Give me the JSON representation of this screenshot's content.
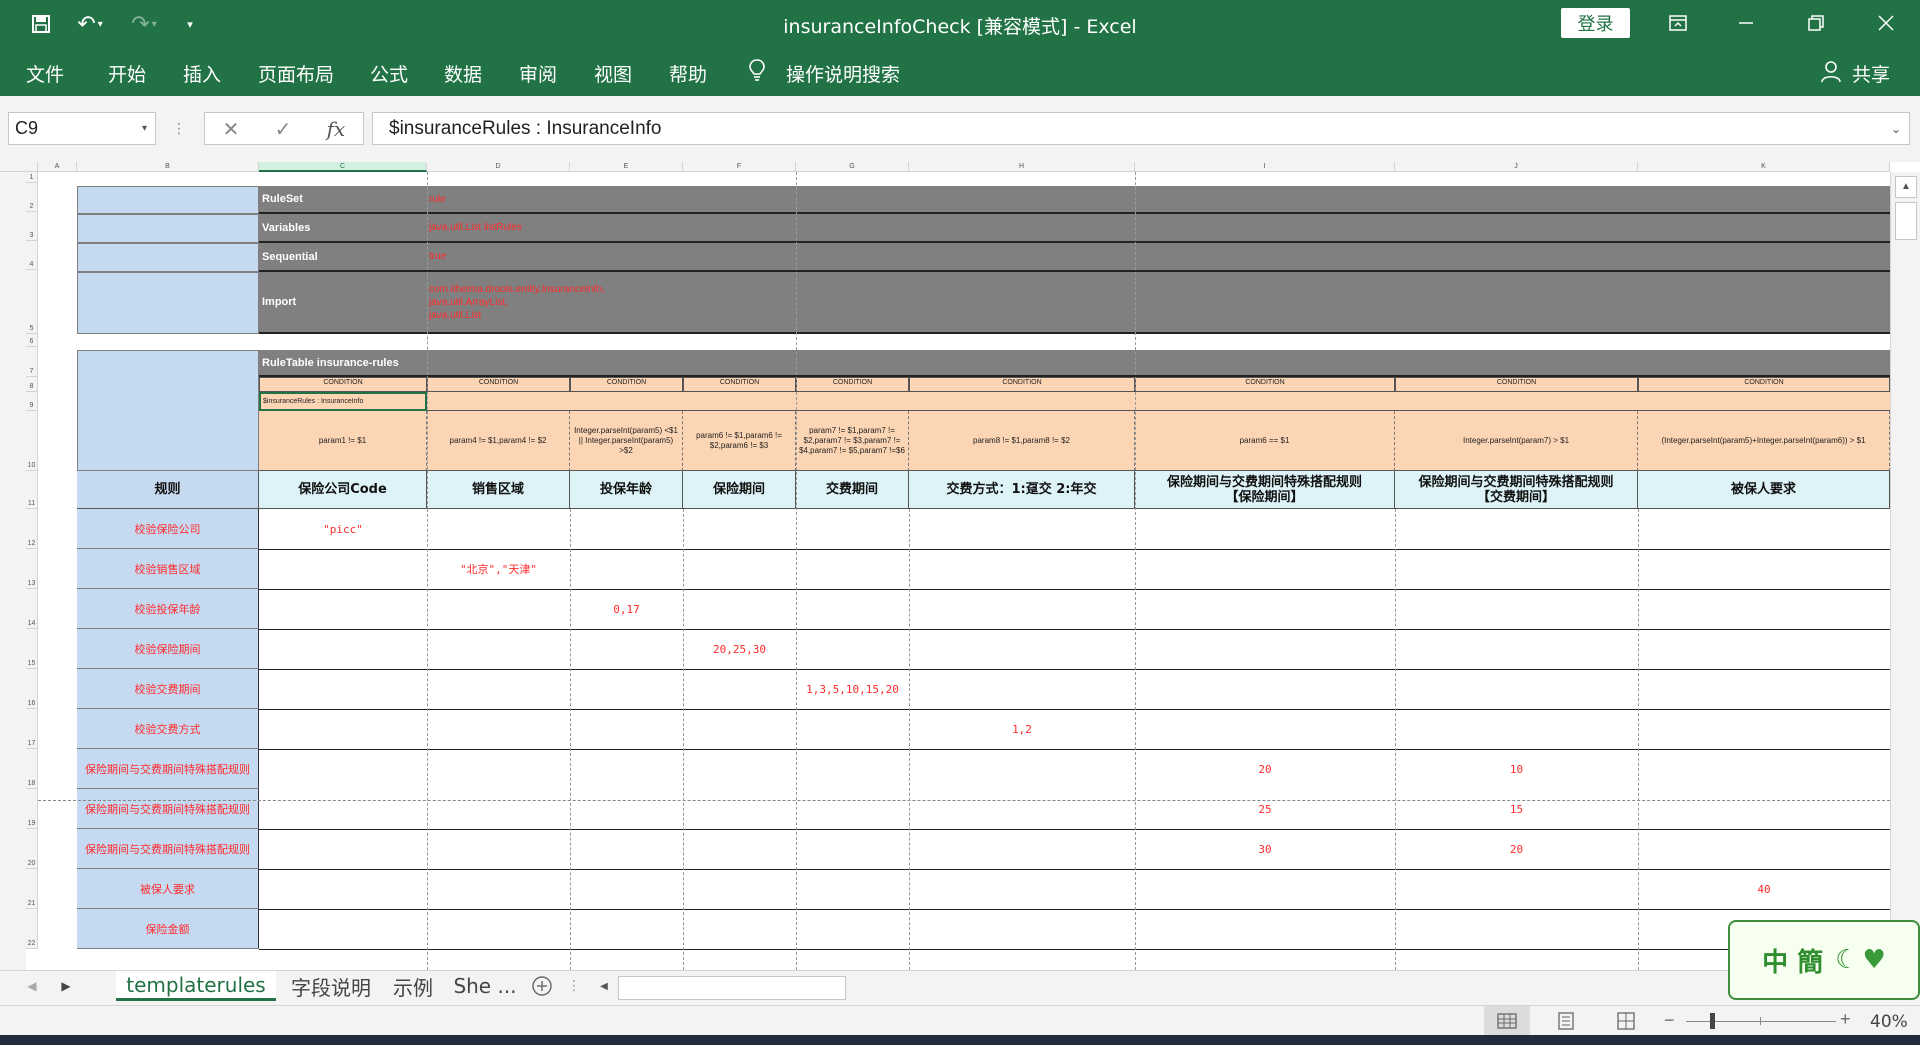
{
  "window": {
    "title": "insuranceInfoCheck  [兼容模式]  -  Excel",
    "login_label": "登录",
    "share_label": "共享"
  },
  "ribbon": {
    "tabs": [
      "文件",
      "开始",
      "插入",
      "页面布局",
      "公式",
      "数据",
      "审阅",
      "视图",
      "帮助"
    ],
    "search_label": "操作说明搜索"
  },
  "formula_bar": {
    "name_box": "C9",
    "formula": "$insuranceRules : InsuranceInfo"
  },
  "grid": {
    "columns": [
      "A",
      "B",
      "C",
      "D",
      "E",
      "F",
      "G",
      "H",
      "I",
      "J",
      "K"
    ],
    "rows": [
      "1",
      "2",
      "3",
      "4",
      "5",
      "6",
      "7",
      "8",
      "9",
      "10",
      "11",
      "12",
      "13",
      "14",
      "15",
      "16",
      "17",
      "18",
      "19",
      "20",
      "21",
      "22"
    ],
    "ruleset": {
      "labels": [
        "RuleSet",
        "Variables",
        "Sequential",
        "Import"
      ],
      "values": [
        "rule",
        "java.util.List listRules",
        "true"
      ],
      "import_lines": [
        "com.itheima.drools.entity.InsuranceInfo,",
        "java.util.ArrayList,",
        "java.util.List"
      ]
    },
    "ruletable_label": "RuleTable insurance-rules",
    "condition_label": "CONDITION",
    "object_type": "$insuranceRules : InsuranceInfo",
    "expressions": [
      "param1 != $1",
      "param4 != $1,param4 != $2",
      "Integer.parseInt(param5) <$1 || Integer.parseInt(param5) >$2",
      "param6 != $1,param6 != $2,param6 != $3",
      "param7 != $1,param7 != $2,param7 != $3,param7 != $4,param7 != $5,param7 !=$6",
      "param8 != $1,param8 != $2",
      "param6 == $1",
      "Integer.parseInt(param7) > $1",
      "(Integer.parseInt(param5)+Integer.parseInt(param6)) > $1"
    ],
    "headers": [
      "规则",
      "保险公司Code",
      "销售区域",
      "投保年龄",
      "保险期间",
      "交费期间",
      "交费方式：1:趸交  2:年交",
      "保险期间与交费期间特殊搭配规则【保险期间】",
      "保险期间与交费期间特殊搭配规则【交费期间】",
      "被保人要求"
    ],
    "rules": [
      {
        "name": "校验保险公司",
        "values": [
          "\"picc\"",
          "",
          "",
          "",
          "",
          "",
          "",
          "",
          ""
        ]
      },
      {
        "name": "校验销售区域",
        "values": [
          "",
          "\"北京\",\"天津\"",
          "",
          "",
          "",
          "",
          "",
          "",
          ""
        ]
      },
      {
        "name": "校验投保年龄",
        "values": [
          "",
          "",
          "0,17",
          "",
          "",
          "",
          "",
          "",
          ""
        ]
      },
      {
        "name": "校验保险期间",
        "values": [
          "",
          "",
          "",
          "20,25,30",
          "",
          "",
          "",
          "",
          ""
        ]
      },
      {
        "name": "校验交费期间",
        "values": [
          "",
          "",
          "",
          "",
          "1,3,5,10,15,20",
          "",
          "",
          "",
          ""
        ]
      },
      {
        "name": "校验交费方式",
        "values": [
          "",
          "",
          "",
          "",
          "",
          "1,2",
          "",
          "",
          ""
        ]
      },
      {
        "name": "保险期间与交费期间特殊搭配规则",
        "values": [
          "",
          "",
          "",
          "",
          "",
          "",
          "20",
          "10",
          ""
        ]
      },
      {
        "name": "保险期间与交费期间特殊搭配规则",
        "values": [
          "",
          "",
          "",
          "",
          "",
          "",
          "25",
          "15",
          ""
        ]
      },
      {
        "name": "保险期间与交费期间特殊搭配规则",
        "values": [
          "",
          "",
          "",
          "",
          "",
          "",
          "30",
          "20",
          ""
        ]
      },
      {
        "name": "被保人要求",
        "values": [
          "",
          "",
          "",
          "",
          "",
          "",
          "",
          "",
          "40"
        ]
      },
      {
        "name": "保险金额",
        "values": [
          "",
          "",
          "",
          "",
          "",
          "",
          "",
          "",
          ""
        ]
      }
    ]
  },
  "sheets": {
    "tabs": [
      "templaterules",
      "字段说明",
      "示例",
      "She ..."
    ],
    "active": "templaterules"
  },
  "status": {
    "zoom": "40%"
  },
  "logo_text": "中 簡"
}
